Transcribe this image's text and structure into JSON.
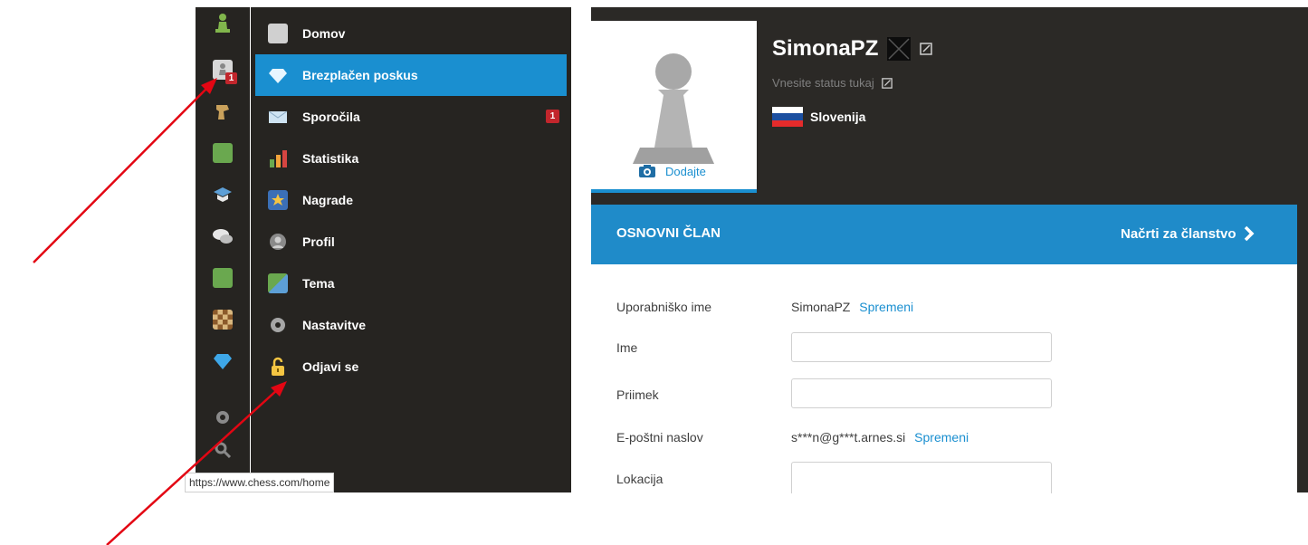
{
  "menu": [
    {
      "label": "Domov",
      "icon": "pawn-icon",
      "active": false
    },
    {
      "label": "Brezplačen poskus",
      "icon": "diamond-icon",
      "active": true
    },
    {
      "label": "Sporočila",
      "icon": "envelope-icon",
      "active": false,
      "badge": "1"
    },
    {
      "label": "Statistika",
      "icon": "bar-chart-icon",
      "active": false
    },
    {
      "label": "Nagrade",
      "icon": "star-icon",
      "active": false
    },
    {
      "label": "Profil",
      "icon": "user-icon",
      "active": false
    },
    {
      "label": "Tema",
      "icon": "theme-icon",
      "active": false
    },
    {
      "label": "Nastavitve",
      "icon": "gear-icon",
      "active": false
    },
    {
      "label": "Odjavi se",
      "icon": "lock-icon",
      "active": false
    }
  ],
  "rail_badge": "1",
  "profile": {
    "username": "SimonaPZ",
    "status_placeholder": "Vnesite status tukaj",
    "country": "Slovenija",
    "add_photo_label": "Dodajte"
  },
  "membership": {
    "title": "OSNOVNI ČLAN",
    "plans_label": "Načrti za članstvo"
  },
  "form": {
    "username_label": "Uporabniško ime",
    "username_value": "SimonaPZ",
    "change_label": "Spremeni",
    "first_name_label": "Ime",
    "last_name_label": "Priimek",
    "email_label": "E-poštni naslov",
    "email_value": "s***n@g***t.arnes.si",
    "location_label": "Lokacija"
  },
  "tooltip_url": "https://www.chess.com/home",
  "colors": {
    "accent": "#1a8fd0",
    "sidebar": "#262421",
    "arrow": "#e30613",
    "badge": "#c2262c"
  }
}
